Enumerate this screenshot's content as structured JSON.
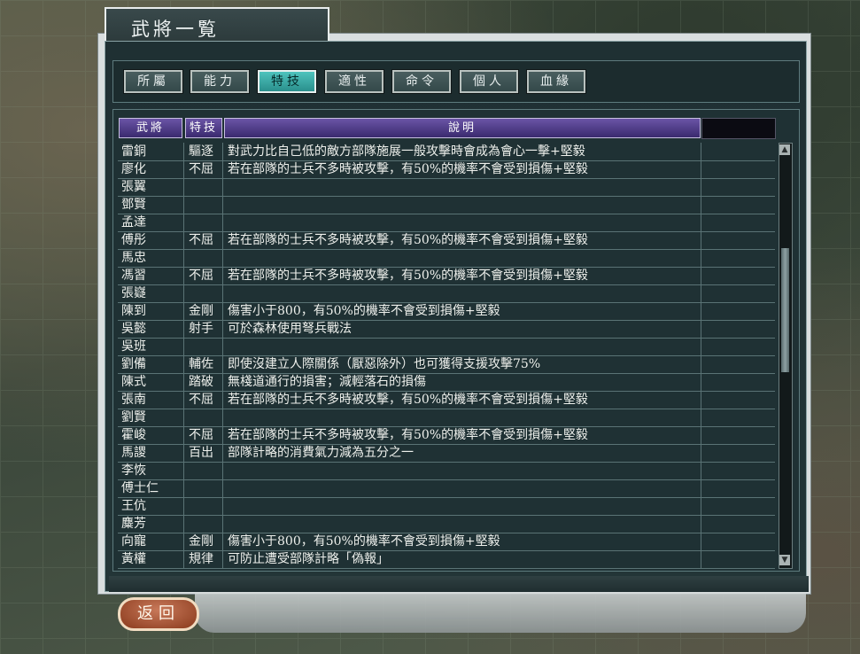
{
  "window": {
    "title": "武將一覧"
  },
  "tabs": [
    {
      "label": "所屬",
      "active": false
    },
    {
      "label": "能力",
      "active": false
    },
    {
      "label": "特技",
      "active": true
    },
    {
      "label": "適性",
      "active": false
    },
    {
      "label": "命令",
      "active": false
    },
    {
      "label": "個人",
      "active": false
    },
    {
      "label": "血緣",
      "active": false
    }
  ],
  "table": {
    "headers": {
      "name": "武將",
      "skill": "特技",
      "desc": "說明"
    },
    "rows": [
      {
        "name": "雷銅",
        "skill": "驅逐",
        "desc": "對武力比自己低的敵方部隊施展一般攻擊時會成為會心一擊+堅毅"
      },
      {
        "name": "廖化",
        "skill": "不屈",
        "desc": "若在部隊的士兵不多時被攻擊，有50%的機率不會受到損傷+堅毅"
      },
      {
        "name": "張翼",
        "skill": "",
        "desc": ""
      },
      {
        "name": "鄧賢",
        "skill": "",
        "desc": ""
      },
      {
        "name": "孟達",
        "skill": "",
        "desc": ""
      },
      {
        "name": "傅彤",
        "skill": "不屈",
        "desc": "若在部隊的士兵不多時被攻擊，有50%的機率不會受到損傷+堅毅"
      },
      {
        "name": "馬忠",
        "skill": "",
        "desc": ""
      },
      {
        "name": "馮習",
        "skill": "不屈",
        "desc": "若在部隊的士兵不多時被攻擊，有50%的機率不會受到損傷+堅毅"
      },
      {
        "name": "張嶷",
        "skill": "",
        "desc": ""
      },
      {
        "name": "陳到",
        "skill": "金剛",
        "desc": "傷害小于800，有50%的機率不會受到損傷+堅毅"
      },
      {
        "name": "吳懿",
        "skill": "射手",
        "desc": "可於森林使用弩兵戰法"
      },
      {
        "name": "吳班",
        "skill": "",
        "desc": ""
      },
      {
        "name": "劉備",
        "skill": "輔佐",
        "desc": "即使沒建立人際關係（厭惡除外）也可獲得支援攻擊75%"
      },
      {
        "name": "陳式",
        "skill": "踏破",
        "desc": "無棧道通行的損害；減輕落石的損傷"
      },
      {
        "name": "張南",
        "skill": "不屈",
        "desc": "若在部隊的士兵不多時被攻擊，有50%的機率不會受到損傷+堅毅"
      },
      {
        "name": "劉賢",
        "skill": "",
        "desc": ""
      },
      {
        "name": "霍峻",
        "skill": "不屈",
        "desc": "若在部隊的士兵不多時被攻擊，有50%的機率不會受到損傷+堅毅"
      },
      {
        "name": "馬謖",
        "skill": "百出",
        "desc": "部隊計略的消費氣力減為五分之一"
      },
      {
        "name": "李恢",
        "skill": "",
        "desc": ""
      },
      {
        "name": "傅士仁",
        "skill": "",
        "desc": ""
      },
      {
        "name": "王伉",
        "skill": "",
        "desc": ""
      },
      {
        "name": "麋芳",
        "skill": "",
        "desc": ""
      },
      {
        "name": "向寵",
        "skill": "金剛",
        "desc": "傷害小于800，有50%的機率不會受到損傷+堅毅"
      },
      {
        "name": "黃權",
        "skill": "規律",
        "desc": "可防止遭受部隊計略「偽報」"
      }
    ]
  },
  "scrollbar": {
    "up": "▲",
    "down": "▼"
  },
  "back_button": {
    "label": "返回"
  },
  "colors": {
    "active_tab": "#2a8f8c",
    "header": "#4a3a88",
    "back_button": "#a04a28"
  }
}
